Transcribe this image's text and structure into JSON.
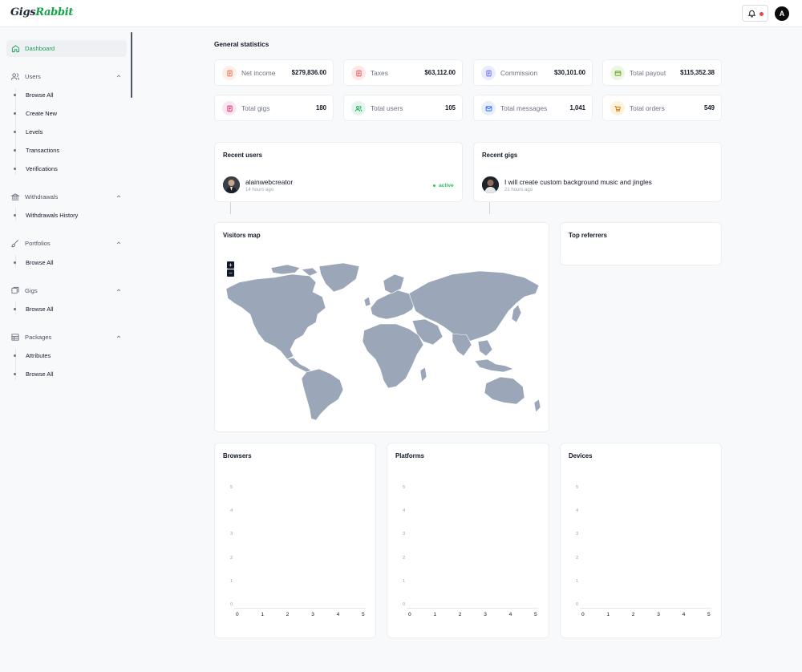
{
  "app": {
    "logo_main": "Gigs",
    "logo_accent": "Rabbit",
    "user_initial": "A"
  },
  "colors": {
    "brand": "#16a34a",
    "active_status": "#22c55e",
    "map_land": "#9ba7b8"
  },
  "sidebar": {
    "dashboard": "Dashboard",
    "users": {
      "label": "Users",
      "items": [
        "Browse All",
        "Create New",
        "Levels",
        "Transactions",
        "Verifications"
      ]
    },
    "withdrawals": {
      "label": "Withdrawals",
      "items": [
        "Withdrawals History"
      ]
    },
    "portfolios": {
      "label": "Portfolios",
      "items": [
        "Browse All"
      ]
    },
    "gigs": {
      "label": "Gigs",
      "items": [
        "Browse All"
      ]
    },
    "packages": {
      "label": "Packages",
      "items": [
        "Attributes",
        "Browse All"
      ]
    }
  },
  "stats": {
    "title": "General statistics",
    "cards": [
      {
        "label": "Net income",
        "value": "$279,836.00",
        "icon": "receipt-icon"
      },
      {
        "label": "Taxes",
        "value": "$63,112.00",
        "icon": "receipt-icon"
      },
      {
        "label": "Commission",
        "value": "$30,101.00",
        "icon": "receipt-icon"
      },
      {
        "label": "Total payout",
        "value": "$115,352.38",
        "icon": "wallet-icon"
      },
      {
        "label": "Total gigs",
        "value": "180",
        "icon": "receipt-icon"
      },
      {
        "label": "Total users",
        "value": "105",
        "icon": "users-icon"
      },
      {
        "label": "Total messages",
        "value": "1,041",
        "icon": "mail-icon"
      },
      {
        "label": "Total orders",
        "value": "549",
        "icon": "cart-icon"
      }
    ]
  },
  "recent_users": {
    "title": "Recent users",
    "name": "alainwebcreator",
    "time": "14 hours ago",
    "status": "active"
  },
  "recent_gigs": {
    "title": "Recent gigs",
    "name": "I will create custom background music and jingles",
    "time": "21 hours ago"
  },
  "visitors_map": {
    "title": "Visitors map",
    "zoom_in": "+",
    "zoom_out": "−"
  },
  "top_referrers": {
    "title": "Top referrers"
  },
  "chart_data": [
    {
      "type": "bar",
      "title": "Browsers",
      "categories": [
        "0",
        "1",
        "2",
        "3",
        "4",
        "5"
      ],
      "series": [],
      "y_ticks": [
        "5",
        "4",
        "3",
        "2",
        "1",
        "0"
      ],
      "ylim": [
        0,
        5
      ]
    },
    {
      "type": "bar",
      "title": "Platforms",
      "categories": [
        "0",
        "1",
        "2",
        "3",
        "4",
        "5"
      ],
      "series": [],
      "y_ticks": [
        "5",
        "4",
        "3",
        "2",
        "1",
        "0"
      ],
      "ylim": [
        0,
        5
      ]
    },
    {
      "type": "bar",
      "title": "Devices",
      "categories": [
        "0",
        "1",
        "2",
        "3",
        "4",
        "5"
      ],
      "series": [],
      "y_ticks": [
        "5",
        "4",
        "3",
        "2",
        "1",
        "0"
      ],
      "ylim": [
        0,
        5
      ]
    }
  ]
}
